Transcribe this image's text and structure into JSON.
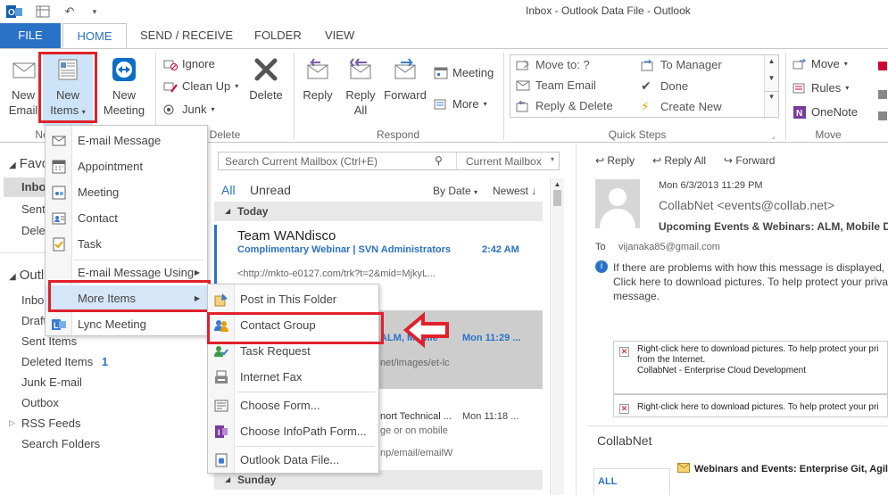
{
  "window": {
    "title": "Inbox - Outlook Data File - Outlook"
  },
  "tabs": {
    "file": "FILE",
    "home": "HOME",
    "send_receive": "SEND / RECEIVE",
    "folder": "FOLDER",
    "view": "VIEW"
  },
  "ribbon": {
    "new_email": [
      "New",
      "Email"
    ],
    "new_items": [
      "New",
      "Items"
    ],
    "new_meeting": [
      "New",
      "Meeting"
    ],
    "new_group_label": "Ne",
    "ignore": "Ignore",
    "clean_up": "Clean Up",
    "junk": "Junk",
    "delete": "Delete",
    "delete_group_label": "Delete",
    "reply": "Reply",
    "reply_all": [
      "Reply",
      "All"
    ],
    "forward": "Forward",
    "meeting": "Meeting",
    "more": "More",
    "respond_group_label": "Respond",
    "quick_steps": {
      "items": [
        "Move to: ?",
        "Team Email",
        "Reply & Delete",
        "To Manager",
        "Done",
        "Create New"
      ],
      "label": "Quick Steps"
    },
    "move": "Move",
    "rules": "Rules",
    "onenote": "OneNote",
    "move_group_label": "Move"
  },
  "nav": {
    "favorites_head": "Favo",
    "favorites": [
      "Inbo",
      "Sent",
      "Dele"
    ],
    "outlook_head": "Outl",
    "folders": [
      {
        "label": "Inbo",
        "count": ""
      },
      {
        "label": "Draft",
        "count": ""
      },
      {
        "label": "Sent Items",
        "count": ""
      },
      {
        "label": "Deleted Items",
        "count": "1"
      },
      {
        "label": "Junk E-mail",
        "count": ""
      },
      {
        "label": "Outbox",
        "count": ""
      },
      {
        "label": "RSS Feeds",
        "count": ""
      },
      {
        "label": "Search Folders",
        "count": ""
      }
    ]
  },
  "search": {
    "placeholder": "Search Current Mailbox (Ctrl+E)",
    "scope": "Current Mailbox"
  },
  "message_list": {
    "filter_all": "All",
    "filter_unread": "Unread",
    "sort_by": "By Date",
    "sort_order": "Newest",
    "groups": [
      "Today",
      "Sunday"
    ],
    "messages": [
      {
        "sender": "Team WANdisco",
        "subject": "Complimentary Webinar | SVN Administrators",
        "time": "2:42 AM",
        "preview": "<http://mkto-e0127.com/trk?t=2&mid=MjkyL..."
      },
      {
        "sender": "",
        "subject": "ALM, Mobile",
        "time": "Mon 11:29 ...",
        "preview": "net/images/et-lc"
      },
      {
        "sender": "",
        "subject": "nort Technical ...",
        "time": "Mon 11:18 ...",
        "preview": "ge or on mobile"
      },
      {
        "sender": "",
        "subject": "",
        "time": "",
        "preview": "np/email/emailW"
      }
    ]
  },
  "reading_pane": {
    "reply": "Reply",
    "reply_all": "Reply All",
    "forward": "Forward",
    "date": "Mon 6/3/2013 11:29 PM",
    "from": "CollabNet <events@collab.net>",
    "subject": "Upcoming Events & Webinars: ALM, Mobile Dev,",
    "to_label": "To",
    "to": "vijanaka85@gmail.com",
    "info": [
      "If there are problems with how this message is displayed, c",
      "Click here to download pictures. To help protect your priva",
      "message."
    ],
    "image_box_1": [
      "Right-click here to download pictures.  To help protect your pri",
      "from the Internet.",
      "CollabNet - Enterprise Cloud Development"
    ],
    "image_box_2": [
      "Right-click here to download pictures.  To help protect your pri"
    ],
    "collabnet": "CollabNet",
    "all_tab": "ALL",
    "bottom_subject": "Webinars and Events: Enterprise Git, Agile"
  },
  "new_items_menu": {
    "items": [
      "E-mail Message",
      "Appointment",
      "Meeting",
      "Contact",
      "Task",
      "E-mail Message Using",
      "More Items",
      "Lync Meeting"
    ]
  },
  "more_items_menu": {
    "items": [
      "Post in This Folder",
      "Contact Group",
      "Task Request",
      "Internet Fax",
      "Choose Form...",
      "Choose InfoPath Form...",
      "Outlook Data File..."
    ]
  },
  "colors": {
    "accent": "#2a72c5",
    "highlight_box": "#e0202a",
    "menu_hover": "#d5e6f8"
  }
}
